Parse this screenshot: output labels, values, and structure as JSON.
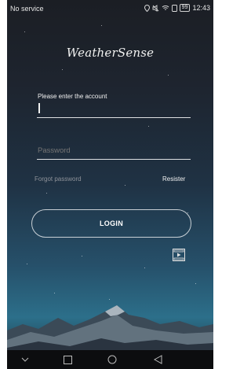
{
  "status_bar": {
    "carrier": "No service",
    "battery": "99",
    "time": "12:43"
  },
  "app": {
    "logo_text": "WeatherSense"
  },
  "login_form": {
    "account_label": "Please enter the account",
    "password_placeholder": "Password",
    "forgot_password": "Forgot password",
    "register": "Resister",
    "login_button": "LOGIN"
  },
  "icons": {
    "status": [
      "location-icon",
      "mute-icon",
      "wifi-icon",
      "sim-icon",
      "battery-icon"
    ],
    "video": "video-tutorial-icon",
    "nav": [
      "hide-keyboard-icon",
      "recents-icon",
      "home-icon",
      "back-icon"
    ]
  },
  "colors": {
    "text": "#f0f0f0",
    "muted_link": "#8e9299",
    "nav_bar": "#0c0d0f"
  }
}
